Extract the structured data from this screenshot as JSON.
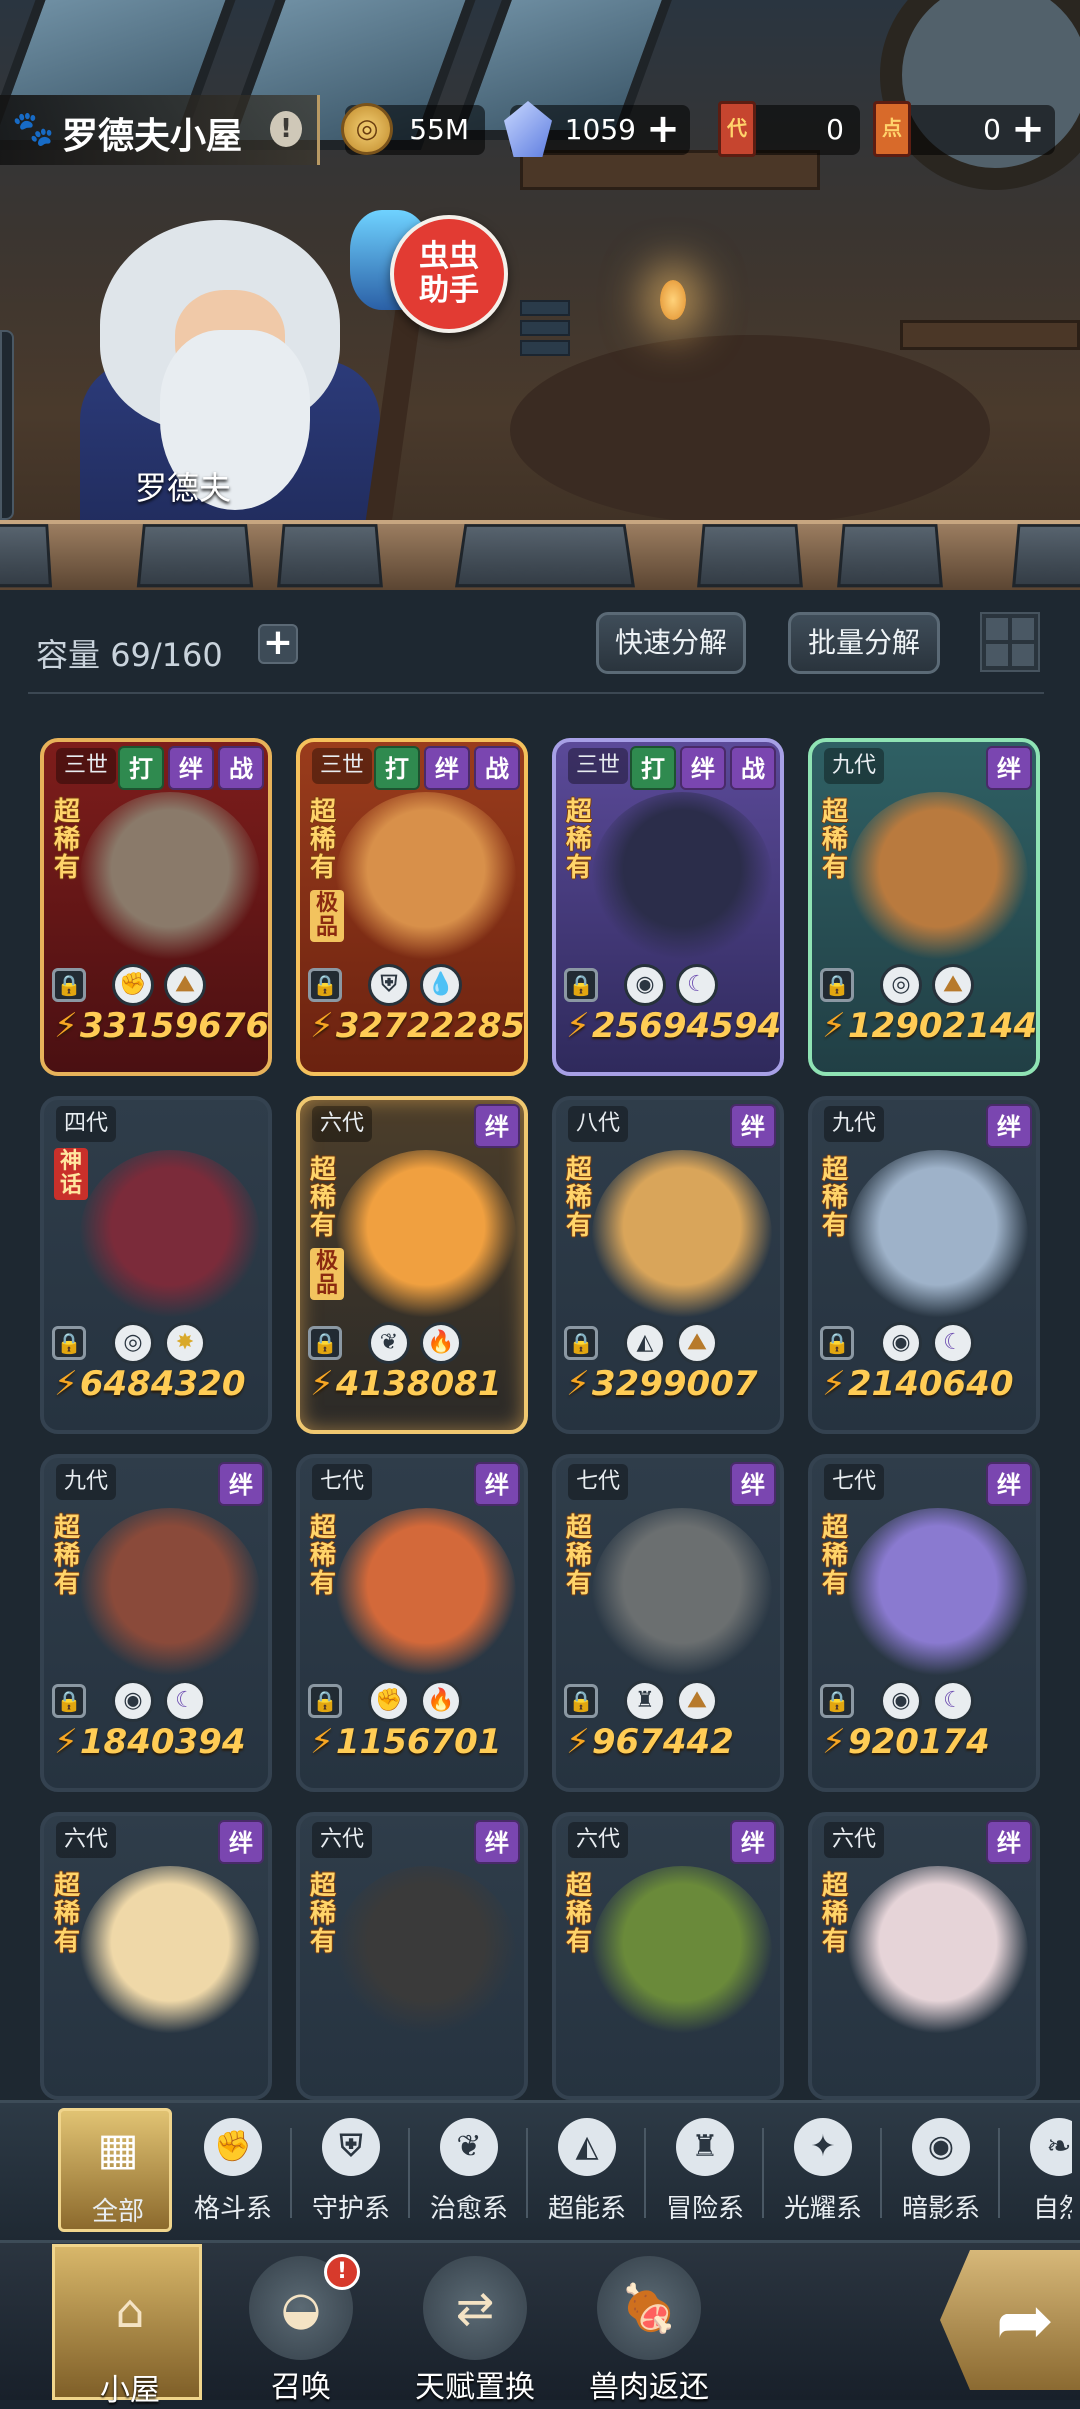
{
  "header": {
    "title": "罗德夫小屋",
    "info_icon": "!",
    "resources": [
      {
        "icon": "coin-icon",
        "glyph": "◎",
        "value": "55M",
        "has_plus": false
      },
      {
        "icon": "crystal-icon",
        "glyph": "",
        "value": "1059",
        "has_plus": true
      },
      {
        "icon": "ticket-red-icon",
        "glyph": "代",
        "value": "0",
        "has_plus": false
      },
      {
        "icon": "ticket-orange-icon",
        "glyph": "点",
        "value": "0",
        "has_plus": true
      }
    ],
    "plus_glyph": "+"
  },
  "scene": {
    "npc_name": "罗德夫",
    "assistant_bubble": "虫虫\n助手"
  },
  "storage": {
    "capacity_label": "容量",
    "capacity_value": "69/160",
    "plus_glyph": "+",
    "quick_decompose": "快速分解",
    "batch_decompose": "批量分解"
  },
  "cards": [
    {
      "gen": "三世",
      "tags": [
        "打",
        "绊",
        "战"
      ],
      "rarity": "超稀有",
      "tier": "",
      "elements": [
        "fist",
        "rock"
      ],
      "elem_glyphs": [
        "✊",
        "⛰"
      ],
      "power": "33159676",
      "theme": "red"
    },
    {
      "gen": "三世",
      "tags": [
        "打",
        "绊",
        "战"
      ],
      "rarity": "超稀有",
      "tier": "极品",
      "elements": [
        "shield",
        "water"
      ],
      "elem_glyphs": [
        "⛨",
        "💧"
      ],
      "power": "32722285",
      "theme": "orange"
    },
    {
      "gen": "三世",
      "tags": [
        "打",
        "绊",
        "战"
      ],
      "rarity": "超稀有",
      "tier": "",
      "elements": [
        "eye",
        "moon"
      ],
      "elem_glyphs": [
        "◉",
        "☾"
      ],
      "power": "25694594",
      "theme": "purple"
    },
    {
      "gen": "九代",
      "tags": [
        "绊"
      ],
      "rarity": "超稀有",
      "tier": "",
      "elements": [
        "target",
        "rock"
      ],
      "elem_glyphs": [
        "◎",
        "⛰"
      ],
      "power": "12902144",
      "theme": "teal"
    },
    {
      "gen": "四代",
      "tags": [],
      "rarity": "",
      "tier": "神话",
      "elements": [
        "target",
        "star"
      ],
      "elem_glyphs": [
        "◎",
        "✸"
      ],
      "power": "6484320",
      "theme": "plain"
    },
    {
      "gen": "六代",
      "tags": [
        "绊"
      ],
      "rarity": "超稀有",
      "tier": "极品",
      "elements": [
        "leaf",
        "fire"
      ],
      "elem_glyphs": [
        "❦",
        "🔥"
      ],
      "power": "4138081",
      "theme": "gold"
    },
    {
      "gen": "八代",
      "tags": [
        "绊"
      ],
      "rarity": "超稀有",
      "tier": "",
      "elements": [
        "alien",
        "rock"
      ],
      "elem_glyphs": [
        "◭",
        "⛰"
      ],
      "power": "3299007",
      "theme": "plain"
    },
    {
      "gen": "九代",
      "tags": [
        "绊"
      ],
      "rarity": "超稀有",
      "tier": "",
      "elements": [
        "eye",
        "moon"
      ],
      "elem_glyphs": [
        "◉",
        "☾"
      ],
      "power": "2140640",
      "theme": "plain"
    },
    {
      "gen": "九代",
      "tags": [
        "绊"
      ],
      "rarity": "超稀有",
      "tier": "",
      "elements": [
        "eye",
        "moon"
      ],
      "elem_glyphs": [
        "◉",
        "☾"
      ],
      "power": "1840394",
      "theme": "plain"
    },
    {
      "gen": "七代",
      "tags": [
        "绊"
      ],
      "rarity": "超稀有",
      "tier": "",
      "elements": [
        "fist",
        "fire"
      ],
      "elem_glyphs": [
        "✊",
        "🔥"
      ],
      "power": "1156701",
      "theme": "plain"
    },
    {
      "gen": "七代",
      "tags": [
        "绊"
      ],
      "rarity": "超稀有",
      "tier": "",
      "elements": [
        "tower",
        "rock"
      ],
      "elem_glyphs": [
        "♜",
        "⛰"
      ],
      "power": "967442",
      "theme": "plain"
    },
    {
      "gen": "七代",
      "tags": [
        "绊"
      ],
      "rarity": "超稀有",
      "tier": "",
      "elements": [
        "eye",
        "moon"
      ],
      "elem_glyphs": [
        "◉",
        "☾"
      ],
      "power": "920174",
      "theme": "plain"
    },
    {
      "gen": "六代",
      "tags": [
        "绊"
      ],
      "rarity": "超稀有",
      "tier": "",
      "elements": [],
      "elem_glyphs": [],
      "power": "",
      "theme": "plain"
    },
    {
      "gen": "六代",
      "tags": [
        "绊"
      ],
      "rarity": "超稀有",
      "tier": "",
      "elements": [],
      "elem_glyphs": [],
      "power": "",
      "theme": "plain"
    },
    {
      "gen": "六代",
      "tags": [
        "绊"
      ],
      "rarity": "超稀有",
      "tier": "",
      "elements": [],
      "elem_glyphs": [],
      "power": "",
      "theme": "plain"
    },
    {
      "gen": "六代",
      "tags": [
        "绊"
      ],
      "rarity": "超稀有",
      "tier": "",
      "elements": [],
      "elem_glyphs": [],
      "power": "",
      "theme": "plain"
    }
  ],
  "filters": [
    {
      "label": "全部",
      "icon": "all-icon",
      "glyph": "▦",
      "active": true
    },
    {
      "label": "格斗系",
      "icon": "fist-icon",
      "glyph": "✊",
      "active": false
    },
    {
      "label": "守护系",
      "icon": "shield-icon",
      "glyph": "⛨",
      "active": false
    },
    {
      "label": "治愈系",
      "icon": "leaf-icon",
      "glyph": "❦",
      "active": false
    },
    {
      "label": "超能系",
      "icon": "alien-icon",
      "glyph": "◭",
      "active": false
    },
    {
      "label": "冒险系",
      "icon": "tower-icon",
      "glyph": "♜",
      "active": false
    },
    {
      "label": "光耀系",
      "icon": "sparkle-icon",
      "glyph": "✦",
      "active": false
    },
    {
      "label": "暗影系",
      "icon": "eye-icon",
      "glyph": "◉",
      "active": false
    },
    {
      "label": "自然",
      "icon": "nature-icon",
      "glyph": "❧",
      "active": false
    }
  ],
  "nav": [
    {
      "label": "小屋",
      "icon": "house-icon",
      "glyph": "⌂",
      "active": true,
      "badge": ""
    },
    {
      "label": "召唤",
      "icon": "egg-icon",
      "glyph": "◒",
      "active": false,
      "badge": "!"
    },
    {
      "label": "天赋置换",
      "icon": "swap-icon",
      "glyph": "⇄",
      "active": false,
      "badge": ""
    },
    {
      "label": "兽肉返还",
      "icon": "meat-icon",
      "glyph": "🍖",
      "active": false,
      "badge": ""
    }
  ],
  "go_glyph": "➦",
  "colors": {
    "accent_gold": "#f0d58c",
    "power_text": "#ffcc55",
    "rarity_text": "#ffd46a",
    "tag_green": "#2f8a4f",
    "tag_purple": "#7a46b0",
    "badge_red": "#d73a2c"
  }
}
